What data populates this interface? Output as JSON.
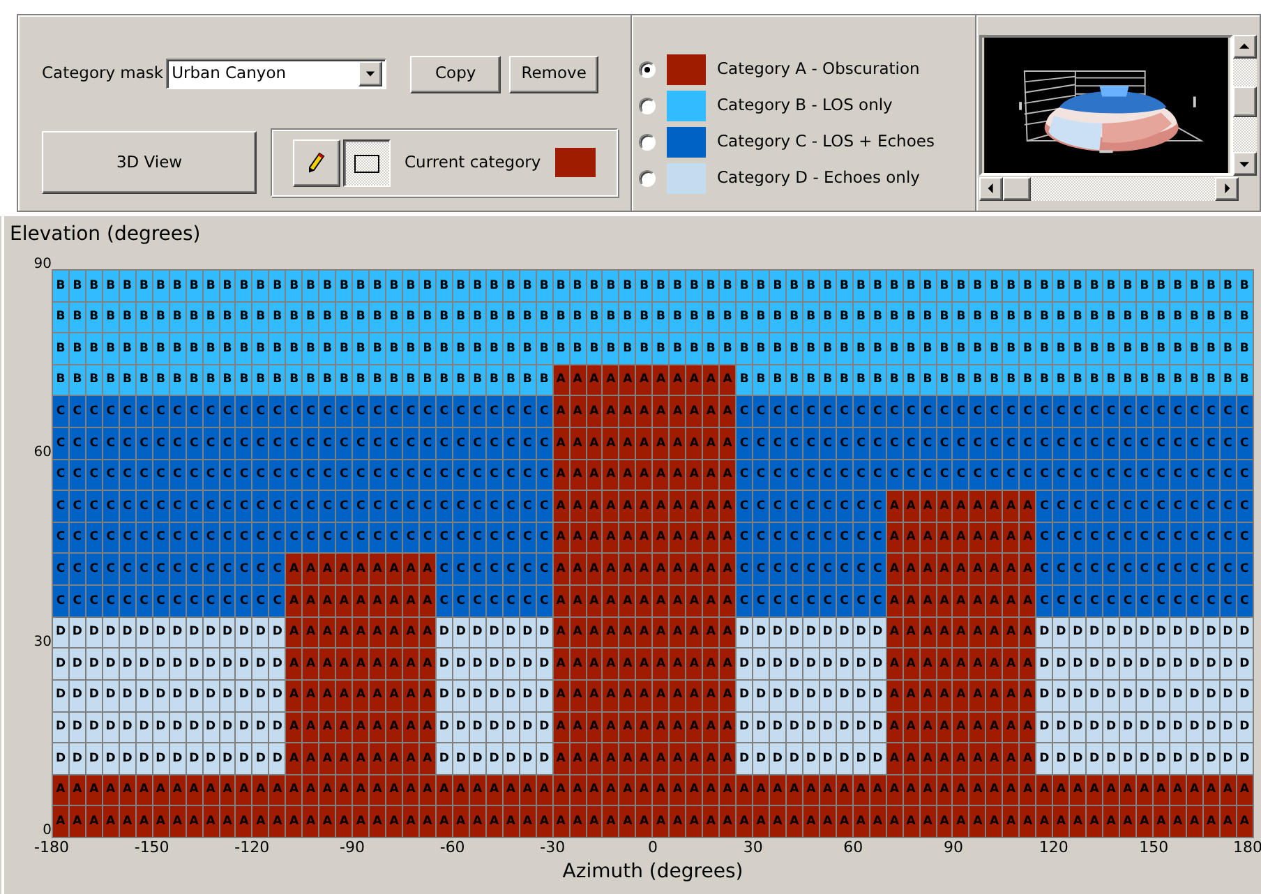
{
  "toolbar": {
    "mask_label": "Category mask",
    "mask_value": "Urban Canyon",
    "buttons": [
      "Copy",
      "Remove"
    ],
    "view_button": "3D View",
    "tools": [
      {
        "kind": "pencil",
        "selected": false
      },
      {
        "kind": "rectangle",
        "selected": true
      }
    ],
    "current_category": {
      "label": "Current category",
      "color": "#a01c00"
    }
  },
  "categories": [
    {
      "label": "Category A - Obscuration",
      "color": "#a01c00",
      "selected": true
    },
    {
      "label": "Category B - LOS only",
      "color": "#33bbff",
      "selected": false
    },
    {
      "label": "Category C - LOS + Echoes",
      "color": "#0062c4",
      "selected": false
    },
    {
      "label": "Category D - Echoes only",
      "color": "#c4dcf0",
      "selected": false
    }
  ],
  "grid": {
    "y_label": "Elevation (degrees)",
    "x_label": "Azimuth (degrees)",
    "y_ticks": [
      "90",
      "60",
      "30",
      "0"
    ],
    "x_ticks": [
      "-180",
      "-150",
      "-120",
      "-90",
      "-60",
      "-30",
      "0",
      "30",
      "60",
      "90",
      "120",
      "150",
      "180"
    ],
    "rows": [
      [
        {
          "color": "#33bbff",
          "cells": [
            "B",
            "B",
            "B",
            "B",
            "B",
            "B",
            "B",
            "B",
            "B",
            "B",
            "B",
            "B",
            "B",
            "B",
            "B",
            "B",
            "B",
            "B",
            "B",
            "B",
            "B",
            "B",
            "B",
            "B",
            "B",
            "B",
            "B",
            "B",
            "B",
            "B",
            "B",
            "B",
            "B",
            "B",
            "B",
            "B",
            "B",
            "B",
            "B",
            "B",
            "B",
            "B",
            "B",
            "B",
            "B",
            "B",
            "B",
            "B",
            "B",
            "B",
            "B",
            "B",
            "B",
            "B",
            "B",
            "B",
            "B",
            "B",
            "B",
            "B",
            "B",
            "B",
            "B",
            "B",
            "B",
            "B",
            "B",
            "B",
            "B",
            "B",
            "B",
            "B"
          ]
        }
      ],
      [
        {
          "color": "#33bbff",
          "cells": [
            "B",
            "B",
            "B",
            "B",
            "B",
            "B",
            "B",
            "B",
            "B",
            "B",
            "B",
            "B",
            "B",
            "B",
            "B",
            "B",
            "B",
            "B",
            "B",
            "B",
            "B",
            "B",
            "B",
            "B",
            "B",
            "B",
            "B",
            "B",
            "B",
            "B",
            "B",
            "B",
            "B",
            "B",
            "B",
            "B",
            "B",
            "B",
            "B",
            "B",
            "B",
            "B",
            "B",
            "B",
            "B",
            "B",
            "B",
            "B",
            "B",
            "B",
            "B",
            "B",
            "B",
            "B",
            "B",
            "B",
            "B",
            "B",
            "B",
            "B",
            "B",
            "B",
            "B",
            "B",
            "B",
            "B",
            "B",
            "B",
            "B",
            "B",
            "B",
            "B"
          ]
        }
      ],
      [
        {
          "color": "#33bbff",
          "cells": [
            "B",
            "B",
            "B",
            "B",
            "B",
            "B",
            "B",
            "B",
            "B",
            "B",
            "B",
            "B",
            "B",
            "B",
            "B",
            "B",
            "B",
            "B",
            "B",
            "B",
            "B",
            "B",
            "B",
            "B",
            "B",
            "B",
            "B",
            "B",
            "B",
            "B",
            "B",
            "B",
            "B",
            "B",
            "B",
            "B",
            "B",
            "B",
            "B",
            "B",
            "B",
            "B",
            "B",
            "B",
            "B",
            "B",
            "B",
            "B",
            "B",
            "B",
            "B",
            "B",
            "B",
            "B",
            "B",
            "B",
            "B",
            "B",
            "B",
            "B",
            "B",
            "B",
            "B",
            "B",
            "B",
            "B",
            "B",
            "B",
            "B",
            "B",
            "B",
            "B"
          ]
        }
      ],
      [
        {
          "color": "#33bbff",
          "cells": [
            "B",
            "B",
            "B",
            "B",
            "B",
            "B",
            "B",
            "B",
            "B",
            "B",
            "B",
            "B",
            "B",
            "B",
            "B",
            "B",
            "B",
            "B",
            "B",
            "B",
            "B",
            "B",
            "B",
            "B",
            "B",
            "B",
            "B",
            "B",
            "B",
            "B"
          ]
        },
        {
          "color": "#a01c00",
          "cells": [
            "A",
            "A",
            "A",
            "A",
            "A",
            "A",
            "A",
            "A",
            "A",
            "A",
            "A"
          ]
        },
        {
          "color": "#33bbff",
          "cells": [
            "B",
            "B",
            "B",
            "B",
            "B",
            "B",
            "B",
            "B",
            "B",
            "B",
            "B",
            "B",
            "B",
            "B",
            "B",
            "B",
            "B",
            "B",
            "B",
            "B",
            "B",
            "B",
            "B",
            "B",
            "B",
            "B",
            "B",
            "B",
            "B",
            "B",
            "B"
          ]
        }
      ],
      [
        {
          "color": "#0062c4",
          "cells": [
            "C",
            "C",
            "C",
            "C",
            "C",
            "C",
            "C",
            "C",
            "C",
            "C",
            "C",
            "C",
            "C",
            "C",
            "C",
            "C",
            "C",
            "C",
            "C",
            "C",
            "C",
            "C",
            "C",
            "C",
            "C",
            "C",
            "C",
            "C",
            "C",
            "C"
          ]
        },
        {
          "color": "#a01c00",
          "cells": [
            "A",
            "A",
            "A",
            "A",
            "A",
            "A",
            "A",
            "A",
            "A",
            "A",
            "A"
          ]
        },
        {
          "color": "#0062c4",
          "cells": [
            "C",
            "C",
            "C",
            "C",
            "C",
            "C",
            "C",
            "C",
            "C",
            "C",
            "C",
            "C",
            "C",
            "C",
            "C",
            "C",
            "C",
            "C",
            "C",
            "C",
            "C",
            "C",
            "C",
            "C",
            "C",
            "C",
            "C",
            "C",
            "C",
            "C",
            "C"
          ]
        }
      ],
      [
        {
          "color": "#0062c4",
          "cells": [
            "C",
            "C",
            "C",
            "C",
            "C",
            "C",
            "C",
            "C",
            "C",
            "C",
            "C",
            "C",
            "C",
            "C",
            "C",
            "C",
            "C",
            "C",
            "C",
            "C",
            "C",
            "C",
            "C",
            "C",
            "C",
            "C",
            "C",
            "C",
            "C",
            "C"
          ]
        },
        {
          "color": "#a01c00",
          "cells": [
            "A",
            "A",
            "A",
            "A",
            "A",
            "A",
            "A",
            "A",
            "A",
            "A",
            "A"
          ]
        },
        {
          "color": "#0062c4",
          "cells": [
            "C",
            "C",
            "C",
            "C",
            "C",
            "C",
            "C",
            "C",
            "C",
            "C",
            "C",
            "C",
            "C",
            "C",
            "C",
            "C",
            "C",
            "C",
            "C",
            "C",
            "C",
            "C",
            "C",
            "C",
            "C",
            "C",
            "C",
            "C",
            "C",
            "C",
            "C"
          ]
        }
      ],
      [
        {
          "color": "#0062c4",
          "cells": [
            "C",
            "C",
            "C",
            "C",
            "C",
            "C",
            "C",
            "C",
            "C",
            "C",
            "C",
            "C",
            "C",
            "C",
            "C",
            "C",
            "C",
            "C",
            "C",
            "C",
            "C",
            "C",
            "C",
            "C",
            "C",
            "C",
            "C",
            "C",
            "C",
            "C"
          ]
        },
        {
          "color": "#a01c00",
          "cells": [
            "A",
            "A",
            "A",
            "A",
            "A",
            "A",
            "A",
            "A",
            "A",
            "A",
            "A"
          ]
        },
        {
          "color": "#0062c4",
          "cells": [
            "C",
            "C",
            "C",
            "C",
            "C",
            "C",
            "C",
            "C",
            "C",
            "C",
            "C",
            "C",
            "C",
            "C",
            "C",
            "C",
            "C",
            "C",
            "C",
            "C",
            "C",
            "C",
            "C",
            "C",
            "C",
            "C",
            "C",
            "C",
            "C",
            "C",
            "C"
          ]
        }
      ],
      [
        {
          "color": "#0062c4",
          "cells": [
            "C",
            "C",
            "C",
            "C",
            "C",
            "C",
            "C",
            "C",
            "C",
            "C",
            "C",
            "C",
            "C",
            "C",
            "C",
            "C",
            "C",
            "C",
            "C",
            "C",
            "C",
            "C",
            "C",
            "C",
            "C",
            "C",
            "C",
            "C",
            "C",
            "C"
          ]
        },
        {
          "color": "#a01c00",
          "cells": [
            "A",
            "A",
            "A",
            "A",
            "A",
            "A",
            "A",
            "A",
            "A",
            "A",
            "A"
          ]
        },
        {
          "color": "#0062c4",
          "cells": [
            "C",
            "C",
            "C",
            "C",
            "C",
            "C",
            "C",
            "C",
            "C"
          ]
        },
        {
          "color": "#a01c00",
          "cells": [
            "A",
            "A",
            "A",
            "A",
            "A",
            "A",
            "A",
            "A",
            "A"
          ]
        },
        {
          "color": "#0062c4",
          "cells": [
            "C",
            "C",
            "C",
            "C",
            "C",
            "C",
            "C",
            "C",
            "C",
            "C",
            "C",
            "C",
            "C"
          ]
        }
      ],
      [
        {
          "color": "#0062c4",
          "cells": [
            "C",
            "C",
            "C",
            "C",
            "C",
            "C",
            "C",
            "C",
            "C",
            "C",
            "C",
            "C",
            "C",
            "C",
            "C",
            "C",
            "C",
            "C",
            "C",
            "C",
            "C",
            "C",
            "C",
            "C",
            "C",
            "C",
            "C",
            "C",
            "C",
            "C"
          ]
        },
        {
          "color": "#a01c00",
          "cells": [
            "A",
            "A",
            "A",
            "A",
            "A",
            "A",
            "A",
            "A",
            "A",
            "A",
            "A"
          ]
        },
        {
          "color": "#0062c4",
          "cells": [
            "C",
            "C",
            "C",
            "C",
            "C",
            "C",
            "C",
            "C",
            "C"
          ]
        },
        {
          "color": "#a01c00",
          "cells": [
            "A",
            "A",
            "A",
            "A",
            "A",
            "A",
            "A",
            "A",
            "A"
          ]
        },
        {
          "color": "#0062c4",
          "cells": [
            "C",
            "C",
            "C",
            "C",
            "C",
            "C",
            "C",
            "C",
            "C",
            "C",
            "C",
            "C",
            "C"
          ]
        }
      ],
      [
        {
          "color": "#0062c4",
          "cells": [
            "C",
            "C",
            "C",
            "C",
            "C",
            "C",
            "C",
            "C",
            "C",
            "C",
            "C",
            "C",
            "C",
            "C"
          ]
        },
        {
          "color": "#a01c00",
          "cells": [
            "A",
            "A",
            "A",
            "A",
            "A",
            "A",
            "A",
            "A",
            "A"
          ]
        },
        {
          "color": "#0062c4",
          "cells": [
            "C",
            "C",
            "C",
            "C",
            "C",
            "C",
            "C"
          ]
        },
        {
          "color": "#a01c00",
          "cells": [
            "A",
            "A",
            "A",
            "A",
            "A",
            "A",
            "A",
            "A",
            "A",
            "A",
            "A"
          ]
        },
        {
          "color": "#0062c4",
          "cells": [
            "C",
            "C",
            "C",
            "C",
            "C",
            "C",
            "C",
            "C",
            "C"
          ]
        },
        {
          "color": "#a01c00",
          "cells": [
            "A",
            "A",
            "A",
            "A",
            "A",
            "A",
            "A",
            "A",
            "A"
          ]
        },
        {
          "color": "#0062c4",
          "cells": [
            "C",
            "C",
            "C",
            "C",
            "C",
            "C",
            "C",
            "C",
            "C",
            "C",
            "C",
            "C",
            "C"
          ]
        }
      ],
      [
        {
          "color": "#0062c4",
          "cells": [
            "C",
            "C",
            "C",
            "C",
            "C",
            "C",
            "C",
            "C",
            "C",
            "C",
            "C",
            "C",
            "C",
            "C"
          ]
        },
        {
          "color": "#a01c00",
          "cells": [
            "A",
            "A",
            "A",
            "A",
            "A",
            "A",
            "A",
            "A",
            "A"
          ]
        },
        {
          "color": "#0062c4",
          "cells": [
            "C",
            "C",
            "C",
            "C",
            "C",
            "C",
            "C"
          ]
        },
        {
          "color": "#a01c00",
          "cells": [
            "A",
            "A",
            "A",
            "A",
            "A",
            "A",
            "A",
            "A",
            "A",
            "A",
            "A"
          ]
        },
        {
          "color": "#0062c4",
          "cells": [
            "C",
            "C",
            "C",
            "C",
            "C",
            "C",
            "C",
            "C",
            "C"
          ]
        },
        {
          "color": "#a01c00",
          "cells": [
            "A",
            "A",
            "A",
            "A",
            "A",
            "A",
            "A",
            "A",
            "A"
          ]
        },
        {
          "color": "#0062c4",
          "cells": [
            "C",
            "C",
            "C",
            "C",
            "C",
            "C",
            "C",
            "C",
            "C",
            "C",
            "C",
            "C",
            "C"
          ]
        }
      ],
      [
        {
          "color": "#c4dcf0",
          "cells": [
            "D",
            "D",
            "D",
            "D",
            "D",
            "D",
            "D",
            "D",
            "D",
            "D",
            "D",
            "D",
            "D",
            "D"
          ]
        },
        {
          "color": "#a01c00",
          "cells": [
            "A",
            "A",
            "A",
            "A",
            "A",
            "A",
            "A",
            "A",
            "A"
          ]
        },
        {
          "color": "#c4dcf0",
          "cells": [
            "D",
            "D",
            "D",
            "D",
            "D",
            "D",
            "D"
          ]
        },
        {
          "color": "#a01c00",
          "cells": [
            "A",
            "A",
            "A",
            "A",
            "A",
            "A",
            "A",
            "A",
            "A",
            "A",
            "A"
          ]
        },
        {
          "color": "#c4dcf0",
          "cells": [
            "D",
            "D",
            "D",
            "D",
            "D",
            "D",
            "D",
            "D",
            "D"
          ]
        },
        {
          "color": "#a01c00",
          "cells": [
            "A",
            "A",
            "A",
            "A",
            "A",
            "A",
            "A",
            "A",
            "A"
          ]
        },
        {
          "color": "#c4dcf0",
          "cells": [
            "D",
            "D",
            "D",
            "D",
            "D",
            "D",
            "D",
            "D",
            "D",
            "D",
            "D",
            "D",
            "D"
          ]
        }
      ],
      [
        {
          "color": "#c4dcf0",
          "cells": [
            "D",
            "D",
            "D",
            "D",
            "D",
            "D",
            "D",
            "D",
            "D",
            "D",
            "D",
            "D",
            "D",
            "D"
          ]
        },
        {
          "color": "#a01c00",
          "cells": [
            "A",
            "A",
            "A",
            "A",
            "A",
            "A",
            "A",
            "A",
            "A"
          ]
        },
        {
          "color": "#c4dcf0",
          "cells": [
            "D",
            "D",
            "D",
            "D",
            "D",
            "D",
            "D"
          ]
        },
        {
          "color": "#a01c00",
          "cells": [
            "A",
            "A",
            "A",
            "A",
            "A",
            "A",
            "A",
            "A",
            "A",
            "A",
            "A"
          ]
        },
        {
          "color": "#c4dcf0",
          "cells": [
            "D",
            "D",
            "D",
            "D",
            "D",
            "D",
            "D",
            "D",
            "D"
          ]
        },
        {
          "color": "#a01c00",
          "cells": [
            "A",
            "A",
            "A",
            "A",
            "A",
            "A",
            "A",
            "A",
            "A"
          ]
        },
        {
          "color": "#c4dcf0",
          "cells": [
            "D",
            "D",
            "D",
            "D",
            "D",
            "D",
            "D",
            "D",
            "D",
            "D",
            "D",
            "D",
            "D"
          ]
        }
      ],
      [
        {
          "color": "#c4dcf0",
          "cells": [
            "D",
            "D",
            "D",
            "D",
            "D",
            "D",
            "D",
            "D",
            "D",
            "D",
            "D",
            "D",
            "D",
            "D"
          ]
        },
        {
          "color": "#a01c00",
          "cells": [
            "A",
            "A",
            "A",
            "A",
            "A",
            "A",
            "A",
            "A",
            "A"
          ]
        },
        {
          "color": "#c4dcf0",
          "cells": [
            "D",
            "D",
            "D",
            "D",
            "D",
            "D",
            "D"
          ]
        },
        {
          "color": "#a01c00",
          "cells": [
            "A",
            "A",
            "A",
            "A",
            "A",
            "A",
            "A",
            "A",
            "A",
            "A",
            "A"
          ]
        },
        {
          "color": "#c4dcf0",
          "cells": [
            "D",
            "D",
            "D",
            "D",
            "D",
            "D",
            "D",
            "D",
            "D"
          ]
        },
        {
          "color": "#a01c00",
          "cells": [
            "A",
            "A",
            "A",
            "A",
            "A",
            "A",
            "A",
            "A",
            "A"
          ]
        },
        {
          "color": "#c4dcf0",
          "cells": [
            "D",
            "D",
            "D",
            "D",
            "D",
            "D",
            "D",
            "D",
            "D",
            "D",
            "D",
            "D",
            "D"
          ]
        }
      ],
      [
        {
          "color": "#c4dcf0",
          "cells": [
            "D",
            "D",
            "D",
            "D",
            "D",
            "D",
            "D",
            "D",
            "D",
            "D",
            "D",
            "D",
            "D",
            "D"
          ]
        },
        {
          "color": "#a01c00",
          "cells": [
            "A",
            "A",
            "A",
            "A",
            "A",
            "A",
            "A",
            "A",
            "A"
          ]
        },
        {
          "color": "#c4dcf0",
          "cells": [
            "D",
            "D",
            "D",
            "D",
            "D",
            "D",
            "D"
          ]
        },
        {
          "color": "#a01c00",
          "cells": [
            "A",
            "A",
            "A",
            "A",
            "A",
            "A",
            "A",
            "A",
            "A",
            "A",
            "A"
          ]
        },
        {
          "color": "#c4dcf0",
          "cells": [
            "D",
            "D",
            "D",
            "D",
            "D",
            "D",
            "D",
            "D",
            "D"
          ]
        },
        {
          "color": "#a01c00",
          "cells": [
            "A",
            "A",
            "A",
            "A",
            "A",
            "A",
            "A",
            "A",
            "A"
          ]
        },
        {
          "color": "#c4dcf0",
          "cells": [
            "D",
            "D",
            "D",
            "D",
            "D",
            "D",
            "D",
            "D",
            "D",
            "D",
            "D",
            "D",
            "D"
          ]
        }
      ],
      [
        {
          "color": "#c4dcf0",
          "cells": [
            "D",
            "D",
            "D",
            "D",
            "D",
            "D",
            "D",
            "D",
            "D",
            "D",
            "D",
            "D",
            "D",
            "D"
          ]
        },
        {
          "color": "#a01c00",
          "cells": [
            "A",
            "A",
            "A",
            "A",
            "A",
            "A",
            "A",
            "A",
            "A"
          ]
        },
        {
          "color": "#c4dcf0",
          "cells": [
            "D",
            "D",
            "D",
            "D",
            "D",
            "D",
            "D"
          ]
        },
        {
          "color": "#a01c00",
          "cells": [
            "A",
            "A",
            "A",
            "A",
            "A",
            "A",
            "A",
            "A",
            "A",
            "A",
            "A"
          ]
        },
        {
          "color": "#c4dcf0",
          "cells": [
            "D",
            "D",
            "D",
            "D",
            "D",
            "D",
            "D",
            "D",
            "D"
          ]
        },
        {
          "color": "#a01c00",
          "cells": [
            "A",
            "A",
            "A",
            "A",
            "A",
            "A",
            "A",
            "A",
            "A"
          ]
        },
        {
          "color": "#c4dcf0",
          "cells": [
            "D",
            "D",
            "D",
            "D",
            "D",
            "D",
            "D",
            "D",
            "D",
            "D",
            "D",
            "D",
            "D"
          ]
        }
      ],
      [
        {
          "color": "#a01c00",
          "cells": [
            "A",
            "A",
            "A",
            "A",
            "A",
            "A",
            "A",
            "A",
            "A",
            "A",
            "A",
            "A",
            "A",
            "A",
            "A",
            "A",
            "A",
            "A",
            "A",
            "A",
            "A",
            "A",
            "A",
            "A",
            "A",
            "A",
            "A",
            "A",
            "A",
            "A",
            "A",
            "A",
            "A",
            "A",
            "A",
            "A",
            "A",
            "A",
            "A",
            "A",
            "A",
            "A",
            "A",
            "A",
            "A",
            "A",
            "A",
            "A",
            "A",
            "A",
            "A",
            "A",
            "A",
            "A",
            "A",
            "A",
            "A",
            "A",
            "A",
            "A",
            "A",
            "A",
            "A",
            "A",
            "A",
            "A",
            "A",
            "A",
            "A",
            "A",
            "A",
            "A"
          ]
        }
      ],
      [
        {
          "color": "#a01c00",
          "cells": [
            "A",
            "A",
            "A",
            "A",
            "A",
            "A",
            "A",
            "A",
            "A",
            "A",
            "A",
            "A",
            "A",
            "A",
            "A",
            "A",
            "A",
            "A",
            "A",
            "A",
            "A",
            "A",
            "A",
            "A",
            "A",
            "A",
            "A",
            "A",
            "A",
            "A",
            "A",
            "A",
            "A",
            "A",
            "A",
            "A",
            "A",
            "A",
            "A",
            "A",
            "A",
            "A",
            "A",
            "A",
            "A",
            "A",
            "A",
            "A",
            "A",
            "A",
            "A",
            "A",
            "A",
            "A",
            "A",
            "A",
            "A",
            "A",
            "A",
            "A",
            "A",
            "A",
            "A",
            "A",
            "A",
            "A",
            "A",
            "A",
            "A",
            "A",
            "A",
            "A"
          ]
        }
      ]
    ]
  }
}
